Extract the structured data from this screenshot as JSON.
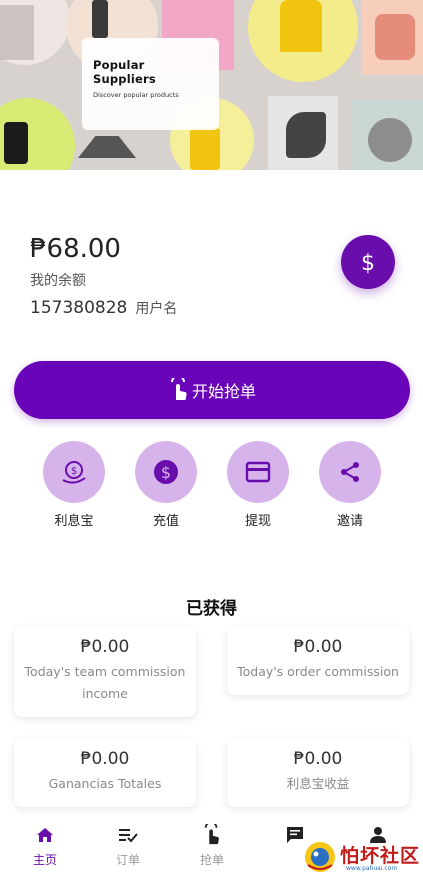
{
  "banner": {
    "title": "Popular Suppliers",
    "subtitle": "Discover popular products"
  },
  "balance": {
    "amount": "₱68.00",
    "label": "我的余额",
    "user_id": "157380828",
    "user_label": "用户名",
    "action_icon": "dollar-icon"
  },
  "start_button": {
    "label": "开始抢单",
    "icon": "tap-icon"
  },
  "quick_actions": [
    {
      "label": "利息宝",
      "icon": "interest-icon"
    },
    {
      "label": "充值",
      "icon": "dollar-circle-icon"
    },
    {
      "label": "提现",
      "icon": "card-icon"
    },
    {
      "label": "邀请",
      "icon": "share-icon"
    }
  ],
  "earned": {
    "title": "已获得",
    "cards": [
      {
        "amount": "₱0.00",
        "label": "Today's team commission income"
      },
      {
        "amount": "₱0.00",
        "label": "Today's order commission"
      },
      {
        "amount": "₱0.00",
        "label": "Ganancias Totales"
      },
      {
        "amount": "₱0.00",
        "label": "利息宝收益"
      }
    ]
  },
  "bottom_nav": {
    "items": [
      {
        "label": "主页",
        "icon": "home-icon",
        "active": true
      },
      {
        "label": "订单",
        "icon": "list-check-icon",
        "active": false
      },
      {
        "label": "抢单",
        "icon": "tap-icon",
        "active": false
      },
      {
        "label": "",
        "icon": "message-icon",
        "active": false
      },
      {
        "label": "",
        "icon": "person-icon",
        "active": false
      }
    ]
  },
  "watermark": {
    "text": "怕坏社区",
    "sub": "www.pahuai.com"
  },
  "colors": {
    "primary": "#6a0dad",
    "action_circle": "#d7b3ec"
  }
}
